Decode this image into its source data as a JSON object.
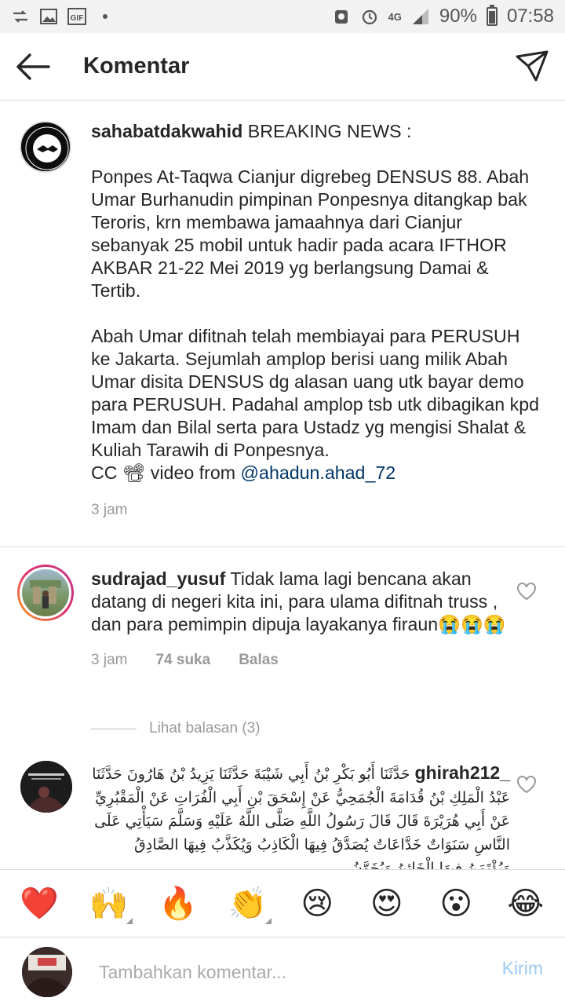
{
  "status_bar": {
    "left_icons": [
      "sync-icon",
      "image-icon",
      "gif-icon",
      "dot-icon"
    ],
    "network": "4G",
    "battery": "90%",
    "time": "07:58"
  },
  "header": {
    "title": "Komentar"
  },
  "caption": {
    "username": "sahabatdakwahid",
    "text_intro": " BREAKING NEWS :\n\nPonpes At-Taqwa Cianjur digrebeg DENSUS 88. Abah Umar Burhanudin pimpinan Ponpesnya ditangkap bak Teroris, krn membawa jamaahnya dari Cianjur sebanyak 25 mobil untuk hadir pada acara IFTHOR AKBAR 21-22 Mei 2019 yg berlangsung Damai & Tertib.\n\nAbah Umar difitnah telah membiayai para PERUSUH ke Jakarta. Sejumlah amplop berisi uang milik Abah Umar disita DENSUS dg alasan uang utk bayar demo para PERUSUH. Padahal amplop tsb utk dibagikan kpd Imam dan Bilal serta para Ustadz yg mengisi Shalat & Kuliah Tarawih di Ponpesnya.\nCC 📽 video from ",
    "mention": "@ahadun.ahad_72",
    "time": "3 jam"
  },
  "comments": [
    {
      "username": "sudrajad_yusuf",
      "text": " Tidak lama lagi bencana akan datang di negeri kita ini, para ulama difitnah truss , dan para pemimpin dipuja layakanya firaun😭😭😭",
      "time": "3 jam",
      "likes": "74 suka",
      "reply": "Balas",
      "view_replies": "Lihat balasan (3)"
    },
    {
      "username": "_ghirah212",
      "text": " حَدَّثَنَا أَبُو بَكْرِ بْنُ أَبِي شَيْبَةَ حَدَّثَنَا يَزِيدُ بْنُ هَارُونَ حَدَّثَنَا عَبْدُ الْمَلِكِ بْنُ قُدَامَةَ الْجُمَحِيُّ عَنْ إِسْحَقَ بْنِ أَبِي الْفُرَاتِ عَنْ الْمَقْبُرِيِّ عَنْ أَبِي هُرَيْرَةَ قَالَ قَالَ رَسُولُ اللَّهِ صَلَّى اللَّهُ عَلَيْهِ وَسَلَّمَ سَيَأْتِي عَلَى النَّاسِ سَنَوَاتٌ خَدَّاعَاتٌ يُصَدَّقُ فِيهَا الْكَاذِبُ وَيُكَذَّبُ فِيهَا الصَّادِقُ وَيُؤْتَمَنُ فِيهَا الْخَائِنُ وَيُخَوَّنُ"
    }
  ],
  "reactions": [
    "❤️",
    "🙌",
    "🔥",
    "👏",
    "😢",
    "😍",
    "😮",
    "😂"
  ],
  "composer": {
    "placeholder": "Tambahkan komentar...",
    "post_label": "Kirim"
  },
  "colors": {
    "text": "#262626",
    "meta": "#999999",
    "mention": "#003569",
    "post_disabled": "#9bc8f2",
    "divider": "#dbdbdb"
  }
}
